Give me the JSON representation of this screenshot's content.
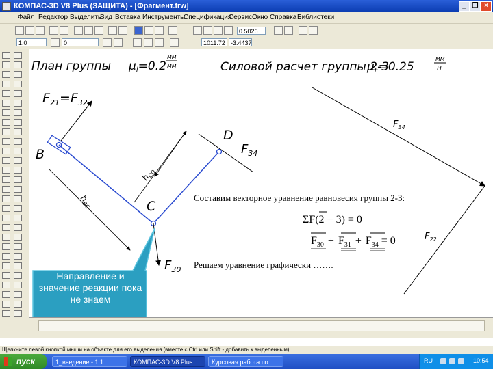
{
  "window": {
    "title": "КОМПАС-3D V8 Plus (ЗАЩИТА) - [Фрагмент.frw]",
    "minimize": "_",
    "restore": "❐",
    "close": "×"
  },
  "menu": [
    "Файл",
    "Редактор",
    "Выделить",
    "Вид",
    "Вставка",
    "Инструменты",
    "Спецификация",
    "Сервис",
    "Окно",
    "Справка",
    "Библиотеки"
  ],
  "toolbar": {
    "zoom_value": "0.5026",
    "layer_value": "1.0",
    "style_value": "0",
    "coord_x": "1011.72",
    "coord_y": "-3.4437"
  },
  "drawing": {
    "plan_title": "План группы",
    "mu_l": "μ",
    "mu_l_sub": "l",
    "mu_l_eq": "=0.2",
    "mu_l_unit_top": "мм",
    "mu_l_unit_bot": "мм",
    "force_title": "Силовой расчет группы 2-3",
    "mu_f": "μ",
    "mu_f_sub": "F",
    "mu_f_eq": "=0.25",
    "mu_f_unit_top": "мм",
    "mu_f_unit_bot": "Н",
    "force_label_top": "F",
    "force_label_top_sub": "21",
    "force_label_top_eq": "=F",
    "force_label_top_sub2": "32",
    "point_b": "B",
    "point_c": "C",
    "point_d": "D",
    "f34": "F",
    "f34_sub": "34",
    "f30": "F",
    "f30_sub": "30",
    "h_cd": "h",
    "h_cd_sub": "CD",
    "h_bc": "h",
    "h_bc_sub": "BC",
    "f34_right": "F",
    "f34_right_sub": "34",
    "f22_right": "F",
    "f22_right_sub": "22"
  },
  "equation": {
    "intro": "Составим векторное уравнение равновесия группы 2-3:",
    "sum_eq": "ΣF(2 − 3) = 0",
    "vec_sum": "F",
    "t1_sub": "30",
    "plus1": "+",
    "t2": "F",
    "t2_sub": "31",
    "plus2": "+",
    "t3": "F",
    "t3_sub": "34",
    "eq_zero": "= 0",
    "solve": "Решаем уравнение графически ……."
  },
  "callout": "Направление и значение реакции пока не знаем",
  "status_hint": "Щелкните левой кнопкой мыши на объекте для его выделения (вместе с Ctrl или Shift - добавить к выделенным)",
  "taskbar": {
    "start": "пуск",
    "tasks": [
      "1_введение - 1.1 ...",
      "КОМПАС-3D V8 Plus ...",
      "Курсовая работа по ..."
    ],
    "lang": "RU",
    "time": "10:54"
  },
  "colors": {
    "accent_blue": "#2a4bd0",
    "callout_fill": "#2b9fc1",
    "titlebar": "#0a3bb0"
  }
}
